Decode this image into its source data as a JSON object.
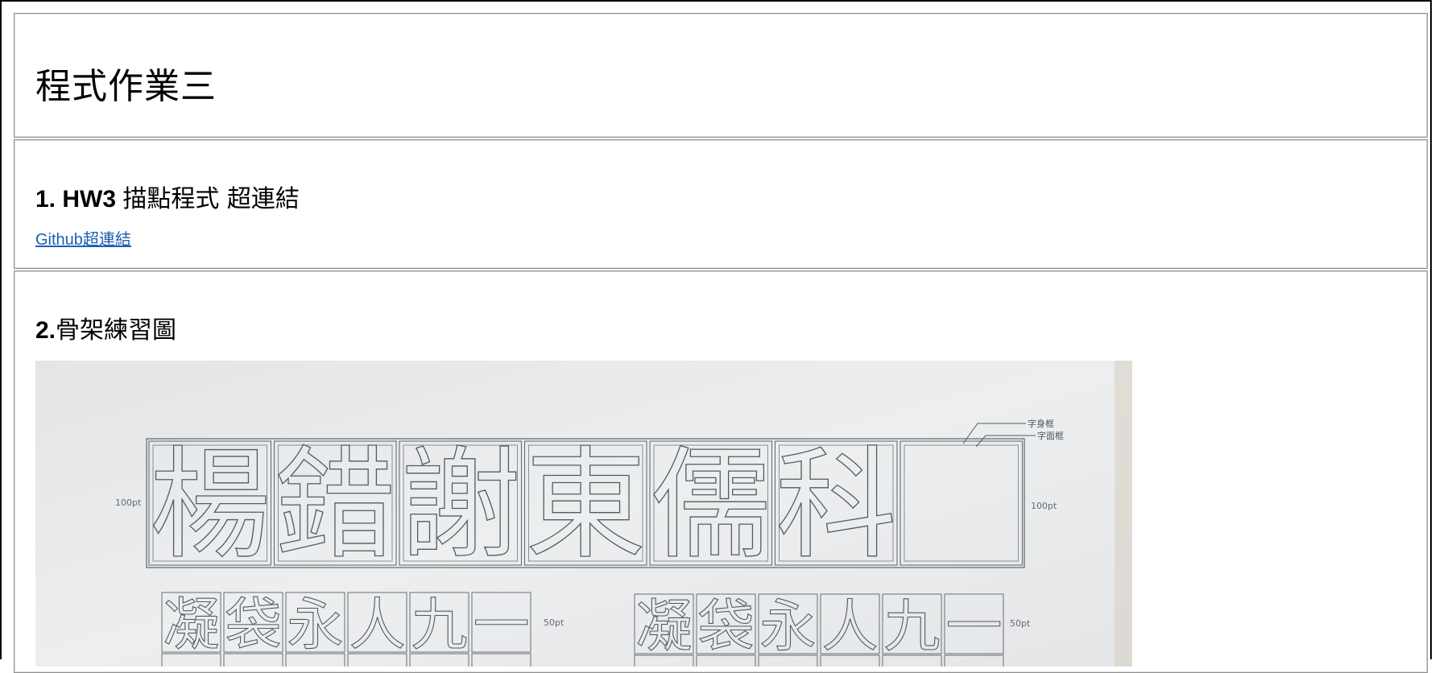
{
  "title": "程式作業三",
  "section1": {
    "number": "1. HW3",
    "heading_text": "描點程式 超連結",
    "link_label": "Github超連結"
  },
  "section2": {
    "number": "2.",
    "heading_text": "骨架練習圖"
  },
  "photo": {
    "top_row_chars": [
      "楊",
      "錯",
      "謝",
      "東",
      "儒",
      "科",
      ""
    ],
    "body_frame_label": "字身框",
    "face_frame_label": "字面框",
    "size_label_large": "100pt",
    "size_label_small": "50pt",
    "practice_chars": [
      "凝",
      "袋",
      "永",
      "人",
      "九",
      "一"
    ]
  },
  "colors": {
    "link": "#1a5fb4",
    "paper": "#e8eaeb",
    "pencil": "#555a60"
  }
}
